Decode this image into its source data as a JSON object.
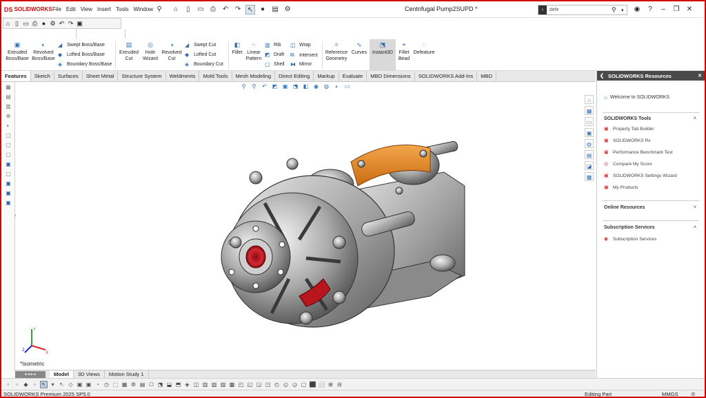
{
  "app": {
    "logo_text": "SOLIDWORKS",
    "logo_mark": "DS"
  },
  "menu": [
    "File",
    "Edit",
    "View",
    "Insert",
    "Tools",
    "Window"
  ],
  "document": {
    "title": "Centrifugal Pump2SUPD *"
  },
  "search": {
    "value": "defe"
  },
  "command_manager": {
    "large": [
      {
        "label1": "Extruded",
        "label2": "Boss/Base",
        "icon": "extruded-boss-icon"
      },
      {
        "label1": "Revolved",
        "label2": "Boss/Base",
        "icon": "revolved-boss-icon"
      },
      {
        "label1": "Extruded",
        "label2": "Cut",
        "icon": "extruded-cut-icon"
      },
      {
        "label1": "Hole",
        "label2": "Wizard",
        "icon": "hole-wizard-icon"
      },
      {
        "label1": "Revolved",
        "label2": "Cut",
        "icon": "revolved-cut-icon"
      },
      {
        "label1": "Fillet",
        "label2": "",
        "icon": "fillet-icon"
      },
      {
        "label1": "Linear",
        "label2": "Pattern",
        "icon": "linear-pattern-icon"
      },
      {
        "label1": "Reference",
        "label2": "Geometry",
        "icon": "reference-geometry-icon"
      },
      {
        "label1": "Curves",
        "label2": "",
        "icon": "curves-icon"
      },
      {
        "label1": "Instant3D",
        "label2": "",
        "icon": "instant3d-icon"
      },
      {
        "label1": "Fillet",
        "label2": "Bead",
        "icon": "fillet-bead-icon"
      },
      {
        "label1": "Defeature",
        "label2": "",
        "icon": "defeature-icon"
      }
    ],
    "boss_stack": [
      "Swept Boss/Base",
      "Lofted Boss/Base",
      "Boundary Boss/Base"
    ],
    "cut_stack": [
      "Swept Cut",
      "Lofted Cut",
      "Boundary Cut"
    ],
    "feature_stack": [
      "Rib",
      "Draft",
      "Shell"
    ],
    "feature_stack2": [
      "Wrap",
      "Intersect",
      "Mirror"
    ]
  },
  "tabs": [
    "Features",
    "Sketch",
    "Surfaces",
    "Sheet Metal",
    "Structure System",
    "Weldments",
    "Mold Tools",
    "Mesh Modeling",
    "Direct Editing",
    "Markup",
    "Evaluate",
    "MBD Dimensions",
    "SOLIDWORKS Add-Ins",
    "MBD"
  ],
  "viewport": {
    "orientation_label": "*Isometric",
    "triad_labels": {
      "x": "X",
      "y": "Y",
      "z": "Z"
    }
  },
  "resources_panel": {
    "title": "SOLIDWORKS Resources",
    "welcome": "Welcome to SOLIDWORKS",
    "tools_heading": "SOLIDWORKS Tools",
    "tools": [
      "Property Tab Builder",
      "SOLIDWORKS Rx",
      "Performance Benchmark Test",
      "Compare My Score",
      "SOLIDWORKS Settings Wizard",
      "My Products"
    ],
    "online_heading": "Online Resources",
    "subscription_heading": "Subscription Services",
    "subscription_items": [
      "Subscription Services"
    ]
  },
  "bottom_tabs": [
    "Model",
    "3D Views",
    "Motion Study 1"
  ],
  "status": {
    "version": "SOLIDWORKS Premium 2025 SP5.0",
    "mode": "Editing Part",
    "units": "MMGS"
  },
  "colors": {
    "frame": "#d00000",
    "accent_orange": "#e88a2a",
    "accent_red": "#c8202a",
    "metal": "#9a9a9a"
  }
}
